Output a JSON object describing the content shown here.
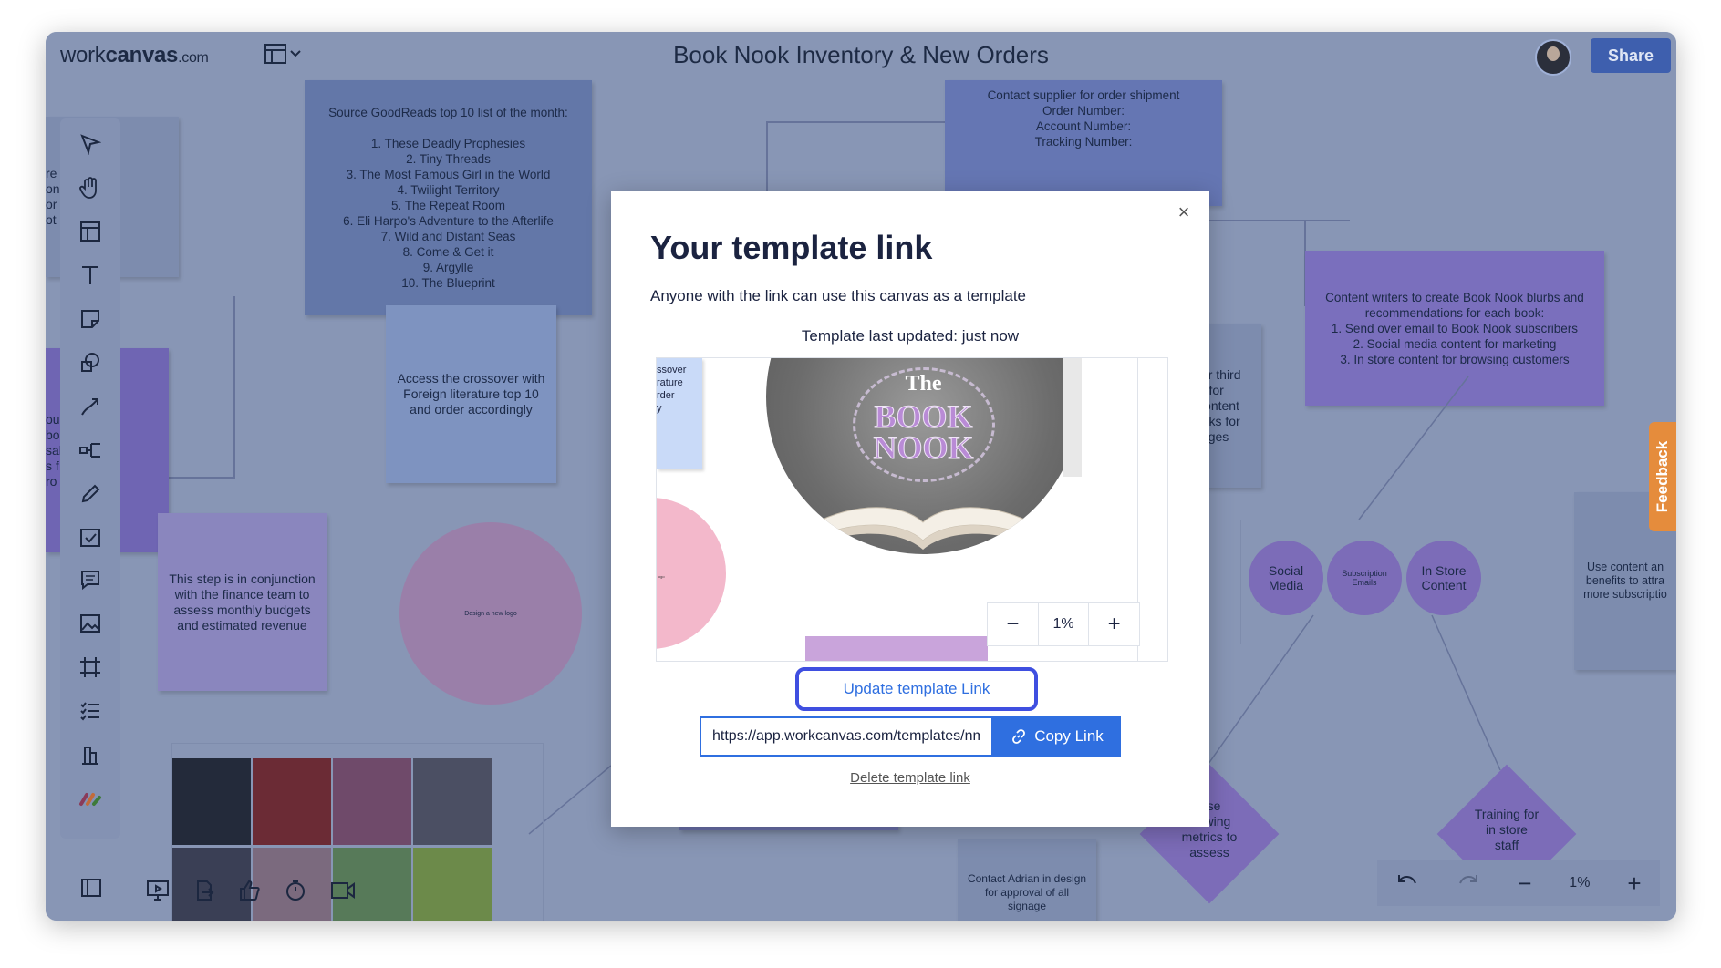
{
  "app": {
    "logo_main": "work",
    "logo_bold": "canvas",
    "logo_suffix": ".com",
    "title": "Book Nook Inventory & New Orders",
    "share_label": "Share"
  },
  "notes": {
    "goodreads": "Source GoodReads top 10 list of the month:\n\n1. These Deadly Prophesies\n2. Tiny Threads\n3. The Most Famous Girl in the World\n4. Twilight Territory\n5. The Repeat Room\n6. Eli Harpo's Adventure to the Afterlife\n7. Wild and Distant Seas\n8. Come & Get it\n9. Argylle\n10. The Blueprint",
    "supplier": "Contact supplier for order shipment\nOrder Number:\nAccount Number:\nTracking Number:",
    "crossover": "Access the crossover with Foreign literature top 10 and order accordingly",
    "finance": "This step is in conjunction with the finance team to assess monthly budgets and estimated revenue",
    "content_writers": "Content writers to create Book Nook blurbs and recommendations for each book:\n1. Send over email to Book Nook subscribers\n2. Social media content for marketing\n3. In store content for browsing customers",
    "vendor_partial": "n use our third\n/ vendor for\ntion of content\nnote books for\nn languages",
    "piles_partial": "re\non piles\nor  oks and\not  ations",
    "sales_partial": "ou  ales of\nbo\nsal  our\ns f  onth\nro  / books",
    "content_benefits": "Use content an\nbenefits to attra\nmore subscriptio",
    "adrian": "Contact Adrian in design for approval of all signage",
    "design_logo": "Design a new logo"
  },
  "circles": {
    "social": "Social\nMedia",
    "subscription": "Subscription\nEmails",
    "instore": "In Store\nContent"
  },
  "diamonds": {
    "viewing": "Use\nviewing\nmetrics to\nassess",
    "training": "Training for\nin store\nstaff"
  },
  "modal": {
    "title": "Your template link",
    "description": "Anyone with the link can use this canvas as a template",
    "updated": "Template last updated: just now",
    "preview_zoom": "1%",
    "preview_partial_note": "ssover\nrature\nrder\ny",
    "preview_tiny_label": "logo",
    "update_link": "Update template Link",
    "url_value": "https://app.workcanvas.com/templates/nmr",
    "copy_label": "Copy Link",
    "delete_link": "Delete template link",
    "close_symbol": "×"
  },
  "logo_text": {
    "the": "The",
    "book": "BOOK",
    "nook": "NOOK"
  },
  "zoom": {
    "level": "1%"
  },
  "feedback_label": "Feedback",
  "colors": {
    "canvas_overlay": "#8896b5",
    "primary_blue": "#2f6fe0",
    "highlight_ring": "#3f4fe0",
    "feedback_orange": "#e58c3c",
    "share_button": "#3e5fae"
  }
}
